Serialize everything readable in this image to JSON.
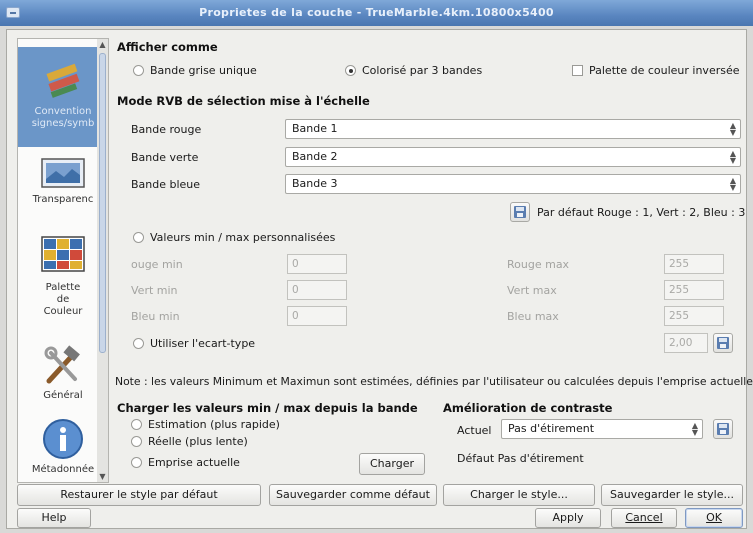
{
  "window": {
    "title": "Proprietes de la couche - TrueMarble.4km.10800x5400"
  },
  "sidebar": {
    "items": [
      {
        "label": "Convention signes/symb",
        "icon": "symbology-icon",
        "selected": true
      },
      {
        "label": "Transparenc",
        "icon": "transparency-icon",
        "selected": false
      },
      {
        "label": "Palette de Couleur",
        "icon": "colormap-icon",
        "selected": false
      },
      {
        "label": "Général",
        "icon": "tools-icon",
        "selected": false
      },
      {
        "label": "Métadonnée",
        "icon": "info-icon",
        "selected": false
      }
    ]
  },
  "display_as": {
    "heading": "Afficher comme",
    "option_gray": "Bande grise unique",
    "option_rgb": "Colorisé par 3 bandes",
    "invert_palette": "Palette de couleur inversée",
    "selected": "rgb"
  },
  "rgb_mode": {
    "heading": "Mode RVB de sélection mise à l'échelle",
    "red_label": "Bande rouge",
    "red_value": "Bande 1",
    "green_label": "Bande verte",
    "green_value": "Bande 2",
    "blue_label": "Bande bleue",
    "blue_value": "Bande 3",
    "default_text": "Par défaut Rouge : 1, Vert : 2, Bleu : 3"
  },
  "minmax": {
    "custom_label": "Valeurs min / max personnalisées",
    "red_min_label": "ouge min",
    "red_min_value": "0",
    "red_max_label": "Rouge max",
    "red_max_value": "255",
    "green_min_label": "Vert min",
    "green_min_value": "0",
    "green_max_label": "Vert max",
    "green_max_value": "255",
    "blue_min_label": "Bleu min",
    "blue_min_value": "0",
    "blue_max_label": "Bleu max",
    "blue_max_value": "255",
    "stddev_label": "Utiliser l'ecart-type",
    "stddev_value": "2,00"
  },
  "note": "Note : les valeurs Minimum et Maximun sont estimées, définies par l'utilisateur ou calculées depuis l'emprise actuelle",
  "load_minmax": {
    "heading": "Charger les valeurs min / max depuis la bande",
    "option_estimate": "Estimation (plus rapide)",
    "option_actual": "Réelle (plus lente)",
    "option_extent": "Emprise actuelle",
    "load_button": "Charger"
  },
  "contrast": {
    "heading": "Amélioration de contraste",
    "current_label": "Actuel",
    "current_value": "Pas d'étirement",
    "default_label": "Défaut",
    "default_value": "Pas d'étirement"
  },
  "style_buttons": {
    "restore": "Restaurer le style par défaut",
    "save_default": "Sauvegarder comme défaut",
    "load": "Charger le style...",
    "save": "Sauvegarder le style..."
  },
  "dialog_buttons": {
    "help": "Help",
    "apply": "Apply",
    "cancel": "Cancel",
    "ok": "OK"
  }
}
